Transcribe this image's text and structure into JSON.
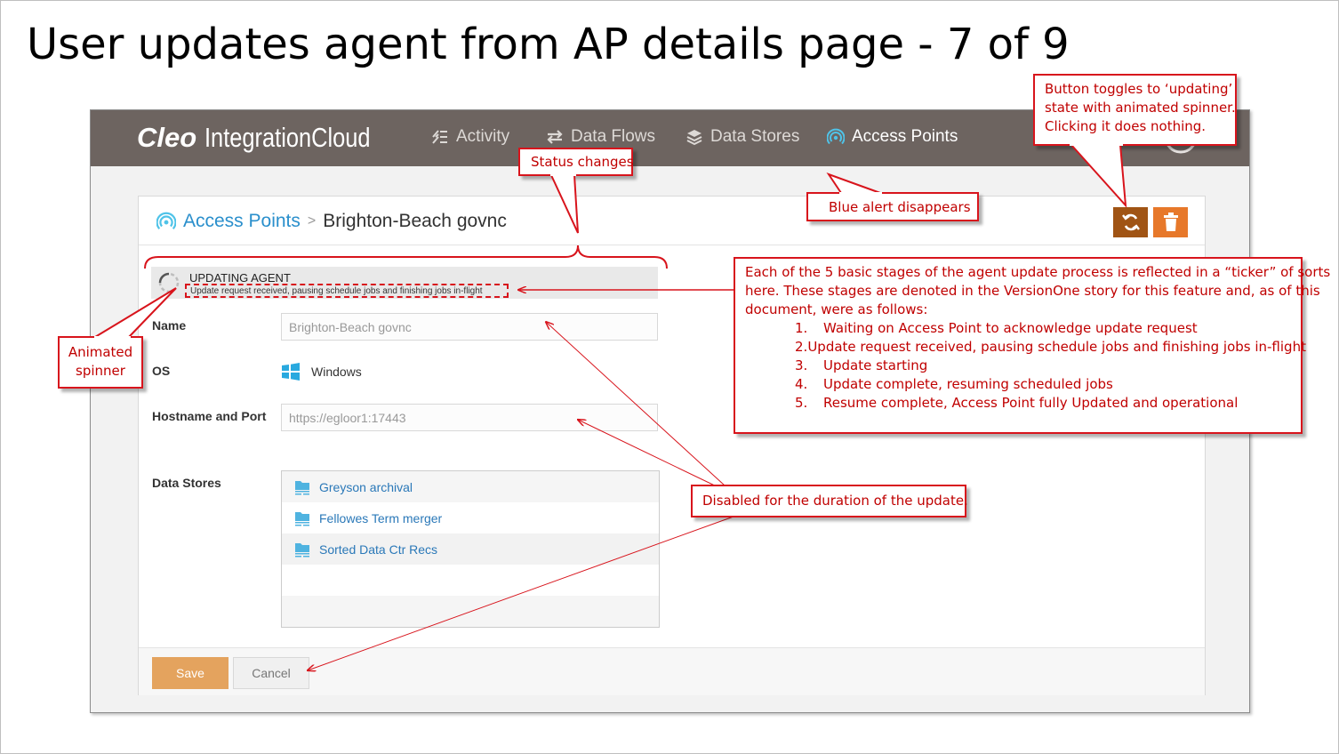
{
  "slide": {
    "title": "User updates agent from AP details page - 7 of 9"
  },
  "app": {
    "logo_bold": "Cleo",
    "logo_rest": "IntegrationCloud",
    "nav": [
      {
        "label": "Activity",
        "icon": "activity-icon"
      },
      {
        "label": "Data Flows",
        "icon": "arrows-exchange-icon"
      },
      {
        "label": "Data Stores",
        "icon": "layers-icon"
      },
      {
        "label": "Access Points",
        "icon": "signal-icon",
        "active": true
      }
    ],
    "breadcrumb": {
      "parent": "Access Points",
      "separator": ">",
      "current": "Brighton-Beach govnc"
    },
    "header_buttons": {
      "update": "refresh-icon",
      "delete": "trash-icon"
    },
    "status": {
      "title": "UPDATING AGENT",
      "message": "Update request received, pausing schedule jobs and finishing jobs in-flight"
    },
    "form": {
      "name_label": "Name",
      "name_value": "Brighton-Beach govnc",
      "os_label": "OS",
      "os_value": "Windows",
      "host_label": "Hostname and Port",
      "host_value": "https://egloor1:17443",
      "ds_label": "Data Stores",
      "data_stores": [
        "Greyson archival",
        "Fellowes Term merger",
        "Sorted Data Ctr Recs"
      ]
    },
    "footer": {
      "save": "Save",
      "cancel": "Cancel"
    },
    "colors": {
      "navbar": "#6d6460",
      "link": "#2a8fcc",
      "update_button": "#a05414",
      "delete_button": "#e7782a",
      "save_button": "#e4a35e"
    }
  },
  "callouts": {
    "button_toggle": [
      "Button toggles to ‘updating’",
      "state with animated spinner.",
      "Clicking it does nothing."
    ],
    "status_changes": "Status changes",
    "blue_alert": "Blue alert disappears",
    "spinner": [
      "Animated",
      "spinner"
    ],
    "ticker_intro": [
      "Each of the 5 basic stages of the agent update process is reflected in a “ticker” of sorts",
      "here. These stages are denoted in the VersionOne story for this feature and, as of this",
      "document, were as follows:"
    ],
    "stages": [
      {
        "num": "1.",
        "text": "Waiting on Access Point to acknowledge update request"
      },
      {
        "num": "2.",
        "text": "Update request received, pausing schedule jobs and finishing jobs in-flight"
      },
      {
        "num": "3.",
        "text": "Update starting"
      },
      {
        "num": "4.",
        "text": "Update complete, resuming scheduled jobs"
      },
      {
        "num": "5.",
        "text": "Resume complete, Access Point fully Updated and operational"
      }
    ],
    "disabled": "Disabled for the duration of the update."
  }
}
